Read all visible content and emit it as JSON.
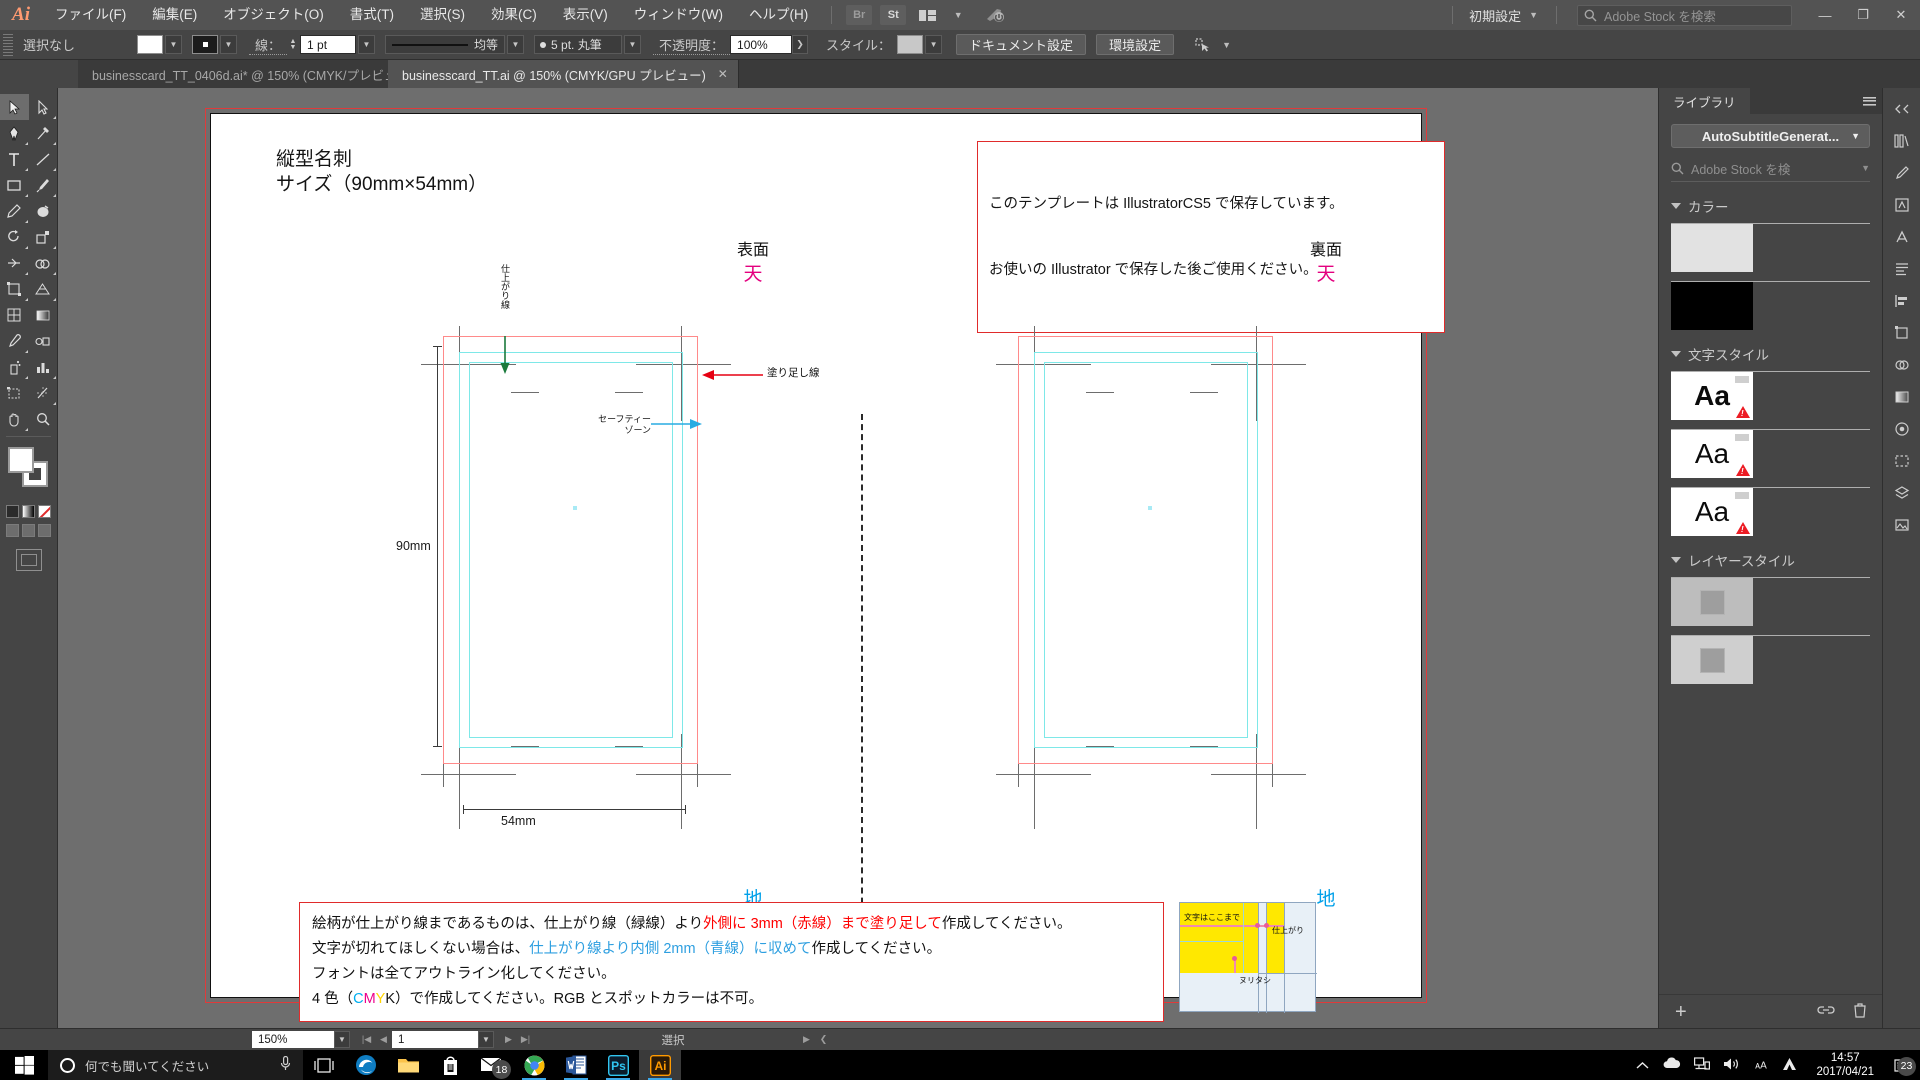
{
  "app": {
    "name": "Adobe Illustrator",
    "logo": "Ai"
  },
  "menubar": {
    "items": [
      "ファイル(F)",
      "編集(E)",
      "オブジェクト(O)",
      "書式(T)",
      "選択(S)",
      "効果(C)",
      "表示(V)",
      "ウィンドウ(W)",
      "ヘルプ(H)"
    ],
    "bridge_icon": "Br",
    "stock_icon": "St",
    "workspace": "初期設定",
    "stock_search_placeholder": "Adobe Stock を検索",
    "window_minimize": "—",
    "window_restore": "❐",
    "window_close": "✕"
  },
  "controlbar": {
    "selection_status": "選択なし",
    "stroke_label": "線：",
    "stroke_weight": "1 pt",
    "stroke_profile": "均等",
    "brush": "5 pt. 丸筆",
    "opacity_label": "不透明度：",
    "opacity_value": "100%",
    "style_label": "スタイル：",
    "document_setup": "ドキュメント設定",
    "preferences": "環境設定"
  },
  "tabs": [
    {
      "label": "businesscard_TT_0406d.ai* @ 150% (CMYK/プレビュー)",
      "active": false,
      "close": "✕"
    },
    {
      "label": "businesscard_TT.ai @ 150% (CMYK/GPU プレビュー)",
      "active": true,
      "close": "✕"
    }
  ],
  "artwork": {
    "title_line1": "縦型名刺",
    "title_line2": "サイズ（90mm×54mm）",
    "template_note_line1": "このテンプレートは IllustratorCS5 で保存しています。",
    "template_note_line2": "お使いの Illustrator で保存した後ご使用ください。",
    "front_label": "表面",
    "back_label": "裏面",
    "top_mark": "天",
    "bottom_mark": "地",
    "trim_line_label": "仕上がり線",
    "bleed_line_label": "塗り足し線",
    "safety_zone_label_line1": "セーフティー",
    "safety_zone_label_line2": "ゾーン",
    "height_dim": "90mm",
    "width_dim": "54mm",
    "instructions": {
      "line1_a": "絵柄が仕上がり線まであるものは、仕上がり線（緑線）より",
      "line1_red": "外側に 3mm（赤線）まで塗り足して",
      "line1_b": "作成してください。",
      "line2_a": "文字が切れてほしくない場合は、",
      "line2_blue": "仕上がり線より内側 2mm（青線）に収めて",
      "line2_b": "作成してください。",
      "line3": "フォントは全てアウトライン化してください。",
      "line4_a": "4 色（",
      "line4_c": "C",
      "line4_m": "M",
      "line4_y": "Y",
      "line4_k": "K",
      "line4_b": "）で作成してください。RGB とスポットカラーは不可。"
    },
    "diagram": {
      "text_limit": "文字はここまで",
      "trim": "仕上がり",
      "bleed": "ヌリタシ"
    }
  },
  "statusbar": {
    "zoom": "150%",
    "page": "1",
    "status": "選択"
  },
  "rightpanel": {
    "tab_label": "ライブラリ",
    "library_name": "AutoSubtitleGenerat...",
    "search_placeholder": "Adobe Stock を検",
    "sections": [
      {
        "title": "カラー",
        "type": "color",
        "swatches": [
          "#e2e2e2",
          "#000000"
        ]
      },
      {
        "title": "文字スタイル",
        "type": "type",
        "items": [
          "Aa",
          "Aa",
          "Aa"
        ]
      },
      {
        "title": "レイヤースタイル",
        "type": "layer",
        "items": [
          "layer-1",
          "layer-2"
        ]
      }
    ],
    "add_label": "+"
  },
  "taskbar": {
    "search_placeholder": "何でも聞いてください",
    "mail_badge": "18",
    "apps": [
      "task-view",
      "edge",
      "file-explorer",
      "store",
      "mail",
      "chrome",
      "word",
      "photoshop",
      "illustrator"
    ],
    "time": "14:57",
    "date": "2017/04/21",
    "notification_badge": "23"
  },
  "colors": {
    "bleed_red": "#ff8a8a",
    "trim_cyan": "#7ee8e8",
    "magenta": "#e4007f",
    "cyan_text": "#00a0e9",
    "warn_red": "#e02b2b",
    "green_arrow": "#1a7a3c"
  }
}
